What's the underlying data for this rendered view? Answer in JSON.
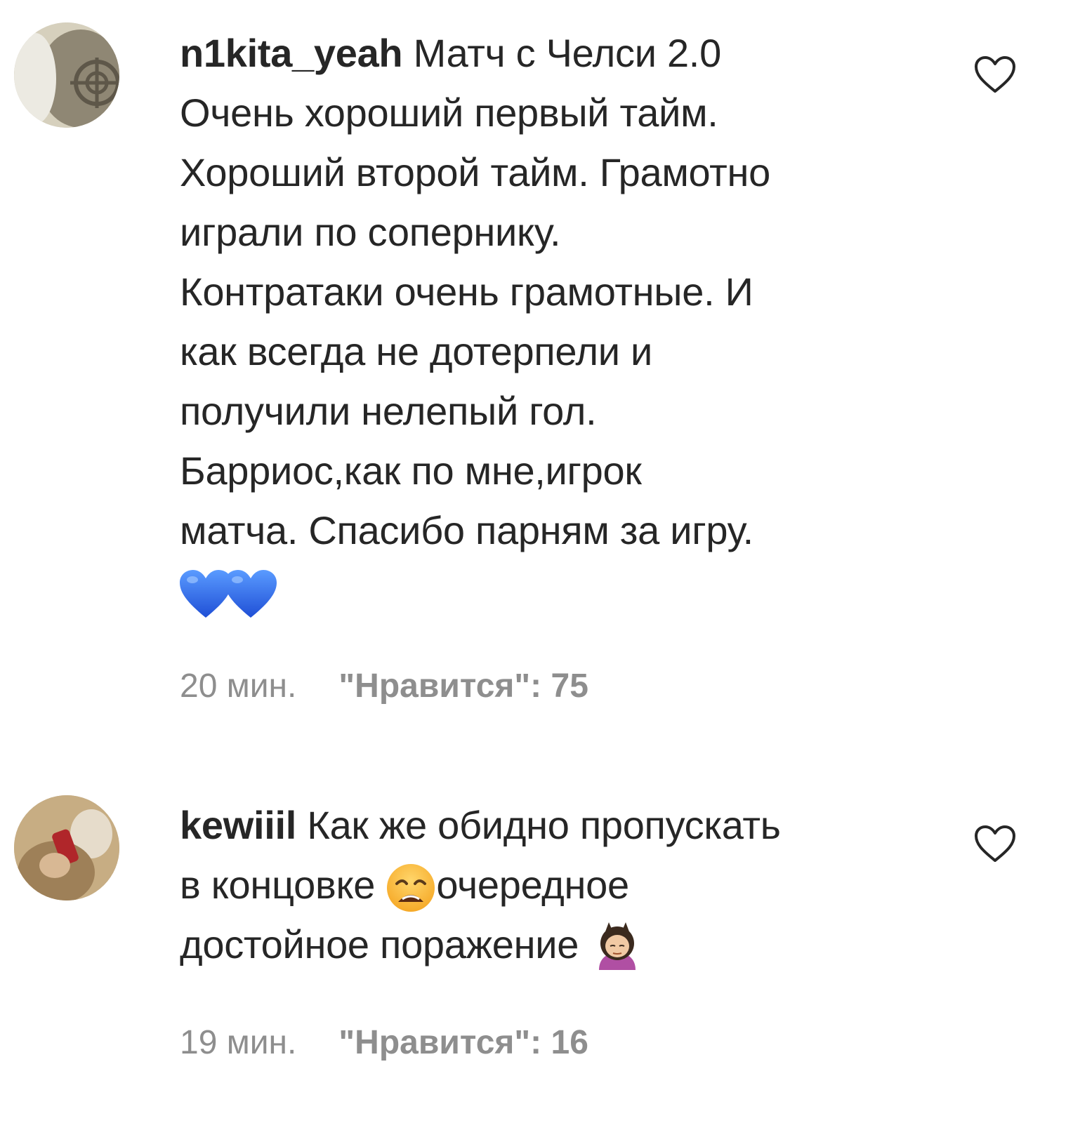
{
  "comments": [
    {
      "username": "n1kita_yeah",
      "lines": [
        " Матч с Челси 2.0",
        "Очень хороший первый тайм.",
        "Хороший второй тайм. Грамотно",
        "играли по сопернику.",
        "Контратаки очень грамотные. И",
        "как всегда не дотерпели и",
        "получили нелепый гол.",
        "Барриос,как по мне,игрок",
        "матча. Спасибо парням за игру."
      ],
      "emoji": [
        "blue-heart",
        "blue-heart"
      ],
      "time": "20 мин.",
      "likes": "\"Нравится\": 75",
      "avatar_icon": "avatar-photo",
      "like_icon": "heart-outline-icon"
    },
    {
      "username": "kewiiil",
      "line1": " Как же обидно пропускать",
      "line2_a": "в концовке ",
      "line2_emoji": "weary-face",
      "line2_b": "очередное",
      "line3": "достойное поражение ",
      "line3_emoji": "woman-bowing",
      "time": "19 мин.",
      "likes": "\"Нравится\": 16",
      "avatar_icon": "avatar-photo",
      "like_icon": "heart-outline-icon"
    }
  ],
  "colors": {
    "text": "#262626",
    "meta": "#8e8e8e",
    "heart_emoji": "#2c6cf0"
  }
}
